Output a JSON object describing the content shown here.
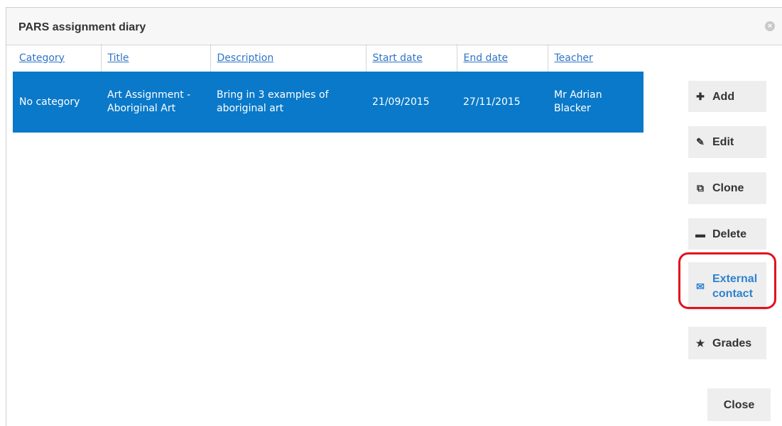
{
  "dialog": {
    "title": "PARS assignment diary",
    "close_icon": "close-circle-icon"
  },
  "table": {
    "columns": [
      "Category",
      "Title",
      "Description",
      "Start date",
      "End date",
      "Teacher"
    ],
    "rows": [
      {
        "category": "No category",
        "title": "Art Assignment - Aboriginal Art",
        "description": "Bring in 3 examples of aboriginal art",
        "start_date": "21/09/2015",
        "end_date": "27/11/2015",
        "teacher": "Mr Adrian Blacker",
        "selected": true
      }
    ]
  },
  "actions": {
    "add": "Add",
    "edit": "Edit",
    "clone": "Clone",
    "delete": "Delete",
    "external_contact": "External contact",
    "grades": "Grades",
    "close": "Close"
  },
  "colors": {
    "selected_row": "#0a79c9",
    "link": "#2e74c9",
    "highlight": "#e0121e"
  }
}
